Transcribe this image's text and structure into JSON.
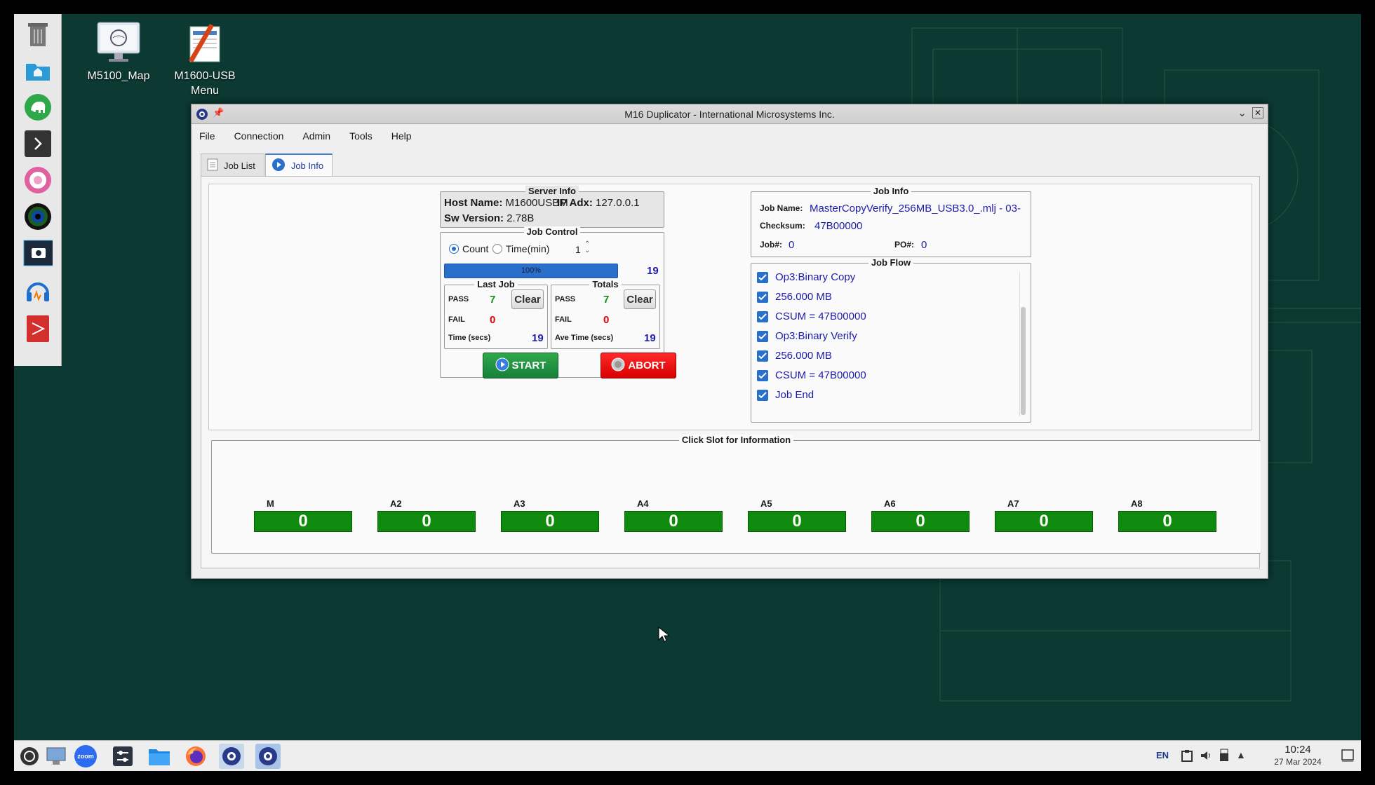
{
  "desktop": {
    "icons": [
      {
        "label_line1": "M5100_Map",
        "label_line2": ""
      },
      {
        "label_line1": "M1600-USB",
        "label_line2": "Menu"
      }
    ]
  },
  "window": {
    "title": "M16 Duplicator - International Microsystems Inc.",
    "menu": [
      "File",
      "Connection",
      "Admin",
      "Tools",
      "Help"
    ],
    "tabs": [
      "Job List",
      "Job Info"
    ],
    "active_tab": "Job Info"
  },
  "server_info": {
    "title": "Server Info",
    "host_label": "Host Name:",
    "host_value": "M1600USBM",
    "ip_label": "IP Adx:",
    "ip_value": "127.0.0.1",
    "sw_label": "Sw Version:",
    "sw_value": "2.78B"
  },
  "job_control": {
    "title": "Job Control",
    "count_label": "Count",
    "time_label": "Time(min)",
    "mode": "Count",
    "spinner_value": "1",
    "progress_text": "100%",
    "progress_fraction": 1.0,
    "progress_count": "19",
    "last_job": {
      "title": "Last Job",
      "pass_label": "PASS",
      "pass": "7",
      "fail_label": "FAIL",
      "fail": "0",
      "time_label": "Time (secs)",
      "time": "19",
      "clear": "Clear"
    },
    "totals": {
      "title": "Totals",
      "pass_label": "PASS",
      "pass": "7",
      "fail_label": "FAIL",
      "fail": "0",
      "time_label": "Ave Time (secs)",
      "time": "19",
      "clear": "Clear"
    },
    "start": "START",
    "abort": "ABORT"
  },
  "job_info": {
    "title": "Job Info",
    "name_label": "Job Name:",
    "name_value": "MasterCopyVerify_256MB_USB3.0_.mlj - 03-",
    "checksum_label": "Checksum:",
    "checksum_value": "47B00000",
    "jobno_label": "Job#:",
    "jobno_value": "0",
    "po_label": "PO#:",
    "po_value": "0"
  },
  "job_flow": {
    "title": "Job Flow",
    "items": [
      "Op3:Binary Copy",
      "256.000 MB",
      "CSUM = 47B00000",
      "Op3:Binary Verify",
      "256.000 MB",
      "CSUM = 47B00000",
      "Job End"
    ]
  },
  "slots": {
    "title": "Click Slot for Information",
    "items": [
      {
        "name": "M",
        "value": "0"
      },
      {
        "name": "A2",
        "value": "0"
      },
      {
        "name": "A3",
        "value": "0"
      },
      {
        "name": "A4",
        "value": "0"
      },
      {
        "name": "A5",
        "value": "0"
      },
      {
        "name": "A6",
        "value": "0"
      },
      {
        "name": "A7",
        "value": "0"
      },
      {
        "name": "A8",
        "value": "0"
      }
    ],
    "color": "#0f8a0f"
  },
  "taskbar": {
    "lang": "EN",
    "time": "10:24",
    "date": "27 Mar 2024",
    "zoom_label": "zoom"
  }
}
